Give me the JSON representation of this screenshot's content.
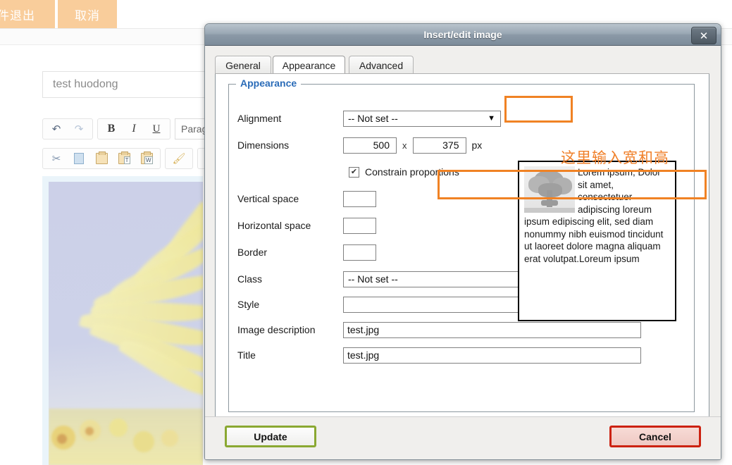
{
  "background": {
    "buttons": [
      {
        "name": "exit",
        "label": "件退出"
      },
      {
        "name": "cancel",
        "label": "取消"
      }
    ],
    "title_input": {
      "value": "test huodong"
    },
    "toolbar": {
      "undo": "undo-icon",
      "redo": "redo-icon",
      "bold": "B",
      "italic": "I",
      "underline": "U",
      "format_select": "Paragraph",
      "cut": "cut-icon",
      "copy": "copy-icon",
      "paste": "paste-icon",
      "paste_text": "paste-text-icon",
      "paste_word": "paste-word-icon",
      "remove_format": "format-brush-icon"
    }
  },
  "dialog": {
    "title": "Insert/edit image",
    "close_label": "✕",
    "tabs": [
      {
        "id": "general",
        "label": "General",
        "active": false
      },
      {
        "id": "appearance",
        "label": "Appearance",
        "active": true
      },
      {
        "id": "advanced",
        "label": "Advanced",
        "active": false
      }
    ],
    "legend": "Appearance",
    "fields": {
      "alignment": {
        "label": "Alignment",
        "value": "-- Not set --"
      },
      "dimensions": {
        "label": "Dimensions",
        "width": "500",
        "separator": "x",
        "height": "375",
        "unit": "px"
      },
      "constrain": {
        "label": "Constrain proportions",
        "checked": true,
        "mark": "✔"
      },
      "vertical_space": {
        "label": "Vertical space",
        "value": ""
      },
      "horizontal_space": {
        "label": "Horizontal space",
        "value": ""
      },
      "border": {
        "label": "Border",
        "value": ""
      },
      "class": {
        "label": "Class",
        "value": "-- Not set --"
      },
      "style": {
        "label": "Style",
        "value": ""
      },
      "image_description": {
        "label": "Image description",
        "value": "test.jpg"
      },
      "title": {
        "label": "Title",
        "value": "test.jpg"
      }
    },
    "preview": {
      "text": "Lorem ipsum, Dolor sit amet, consectetuer adipiscing loreum ipsum edipiscing elit, sed diam nonummy nibh euismod tincidunt ut laoreet dolore magna aliquam erat volutpat.Loreum ipsum",
      "thumbnail": "tree-image"
    },
    "footer": {
      "update_label": "Update",
      "cancel_label": "Cancel"
    }
  },
  "annotations": {
    "callout_text": "这里输入宽和高",
    "color": "#f08224",
    "boxes": [
      "appearance-tab",
      "dimensions-row"
    ]
  },
  "dropdown_arrow": "▼"
}
